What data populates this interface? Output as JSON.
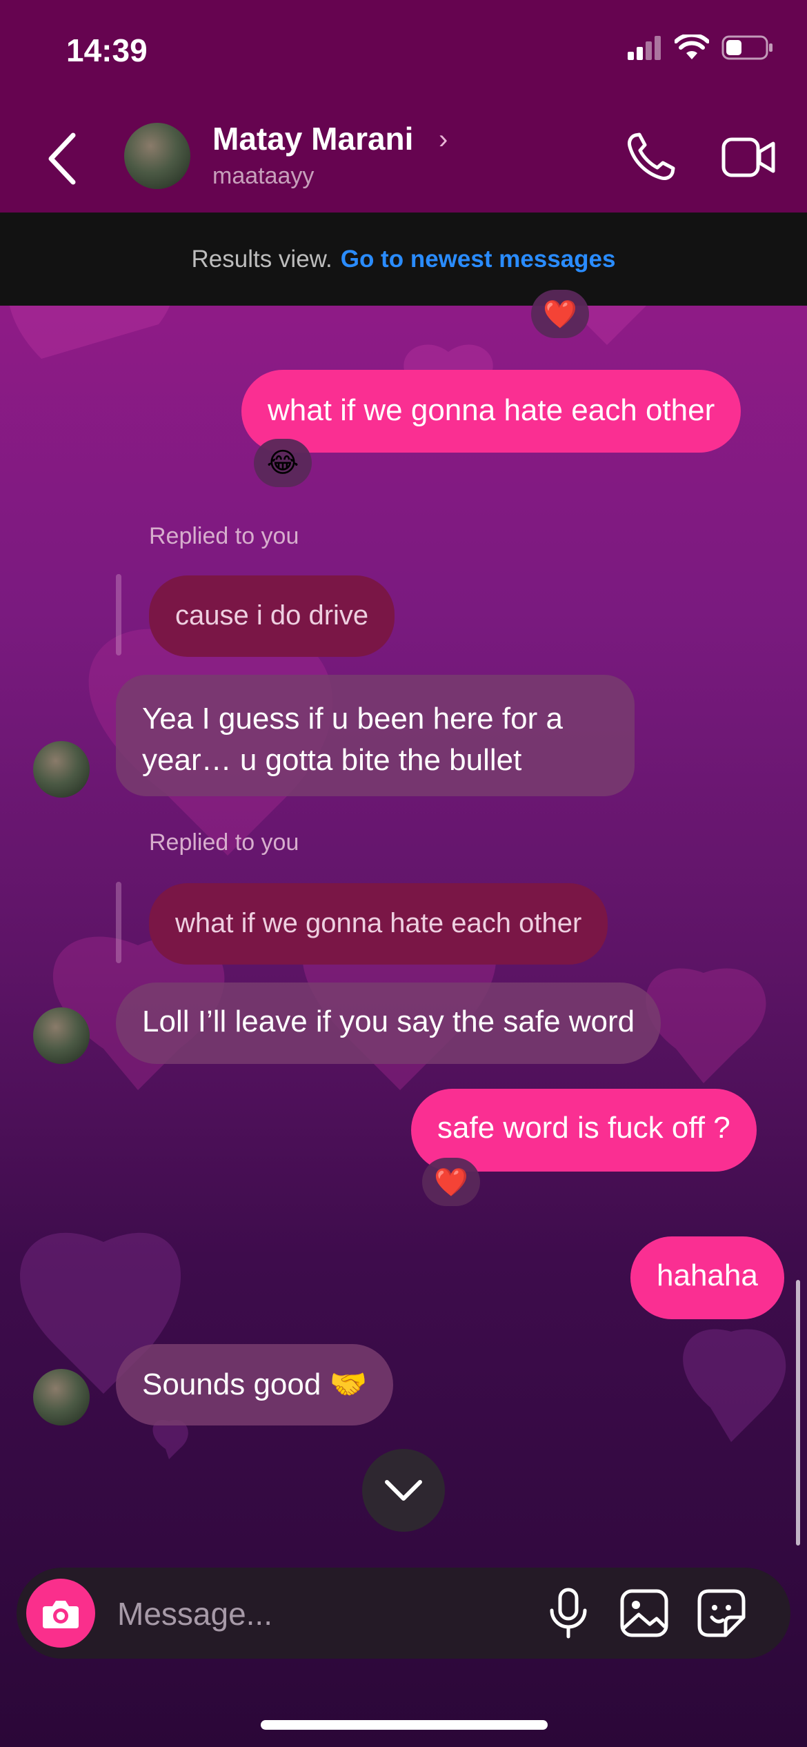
{
  "status_bar": {
    "time": "14:39"
  },
  "header": {
    "back_icon": "chevron-left-icon",
    "name": "Matay Marani",
    "chevron": "›",
    "username": "maataayy",
    "call_icon": "phone-icon",
    "video_icon": "video-camera-icon"
  },
  "banner": {
    "text": "Results view.",
    "link": "Go to newest messages"
  },
  "messages": [
    {
      "sender": "me",
      "text": "what if we gonna hate each other",
      "reaction": "😂"
    },
    {
      "sender": "them",
      "reply_label": "Replied to you",
      "reply_to": "cause i do drive",
      "text_line1": "Yea I guess if u been here for a",
      "text_line2": "year… u gotta bite the  bullet"
    },
    {
      "sender": "them",
      "reply_label": "Replied to you",
      "reply_to": "what if we gonna hate each other",
      "text": "Loll I’ll leave if you say the safe word"
    },
    {
      "sender": "me",
      "text": "safe word is fuck off ?",
      "reaction": "❤️"
    },
    {
      "sender": "me",
      "text": "hahaha"
    },
    {
      "sender": "them",
      "text": "Sounds good 🤝"
    }
  ],
  "top_reaction": "❤️",
  "composer": {
    "placeholder": "Message...",
    "camera_icon": "camera-icon",
    "mic_icon": "microphone-icon",
    "gallery_icon": "image-icon",
    "sticker_icon": "sticker-icon"
  },
  "colors": {
    "header_bg": "#660450",
    "my_bubble": "#fa2f92",
    "link": "#2a8cff"
  }
}
